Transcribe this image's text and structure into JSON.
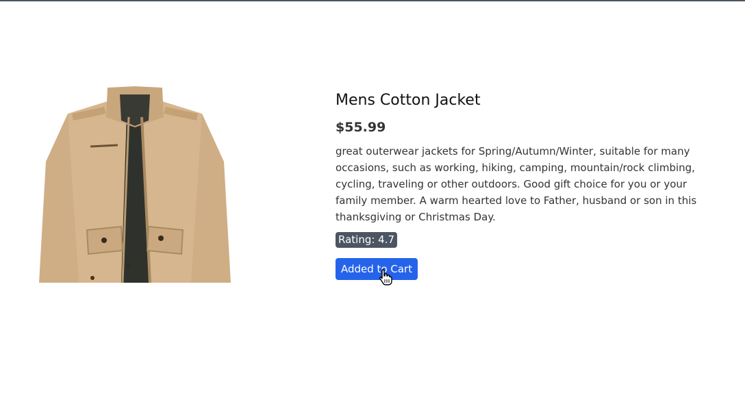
{
  "product": {
    "title": "Mens Cotton Jacket",
    "price": "$55.99",
    "description": "great outerwear jackets for Spring/Autumn/Winter, suitable for many occasions, such as working, hiking, camping, mountain/rock climbing, cycling, traveling or other outdoors. Good gift choice for you or your family member. A warm hearted love to Father, husband or son in this thanksgiving or Christmas Day.",
    "rating_label": "Rating: 4.7",
    "image_icon": "jacket-photo"
  },
  "actions": {
    "cart_button_label": "Added to Cart"
  },
  "colors": {
    "top_bar": "#4b5563",
    "badge": "#4b5563",
    "button": "#2563eb",
    "jacket": "#d2b48c"
  }
}
